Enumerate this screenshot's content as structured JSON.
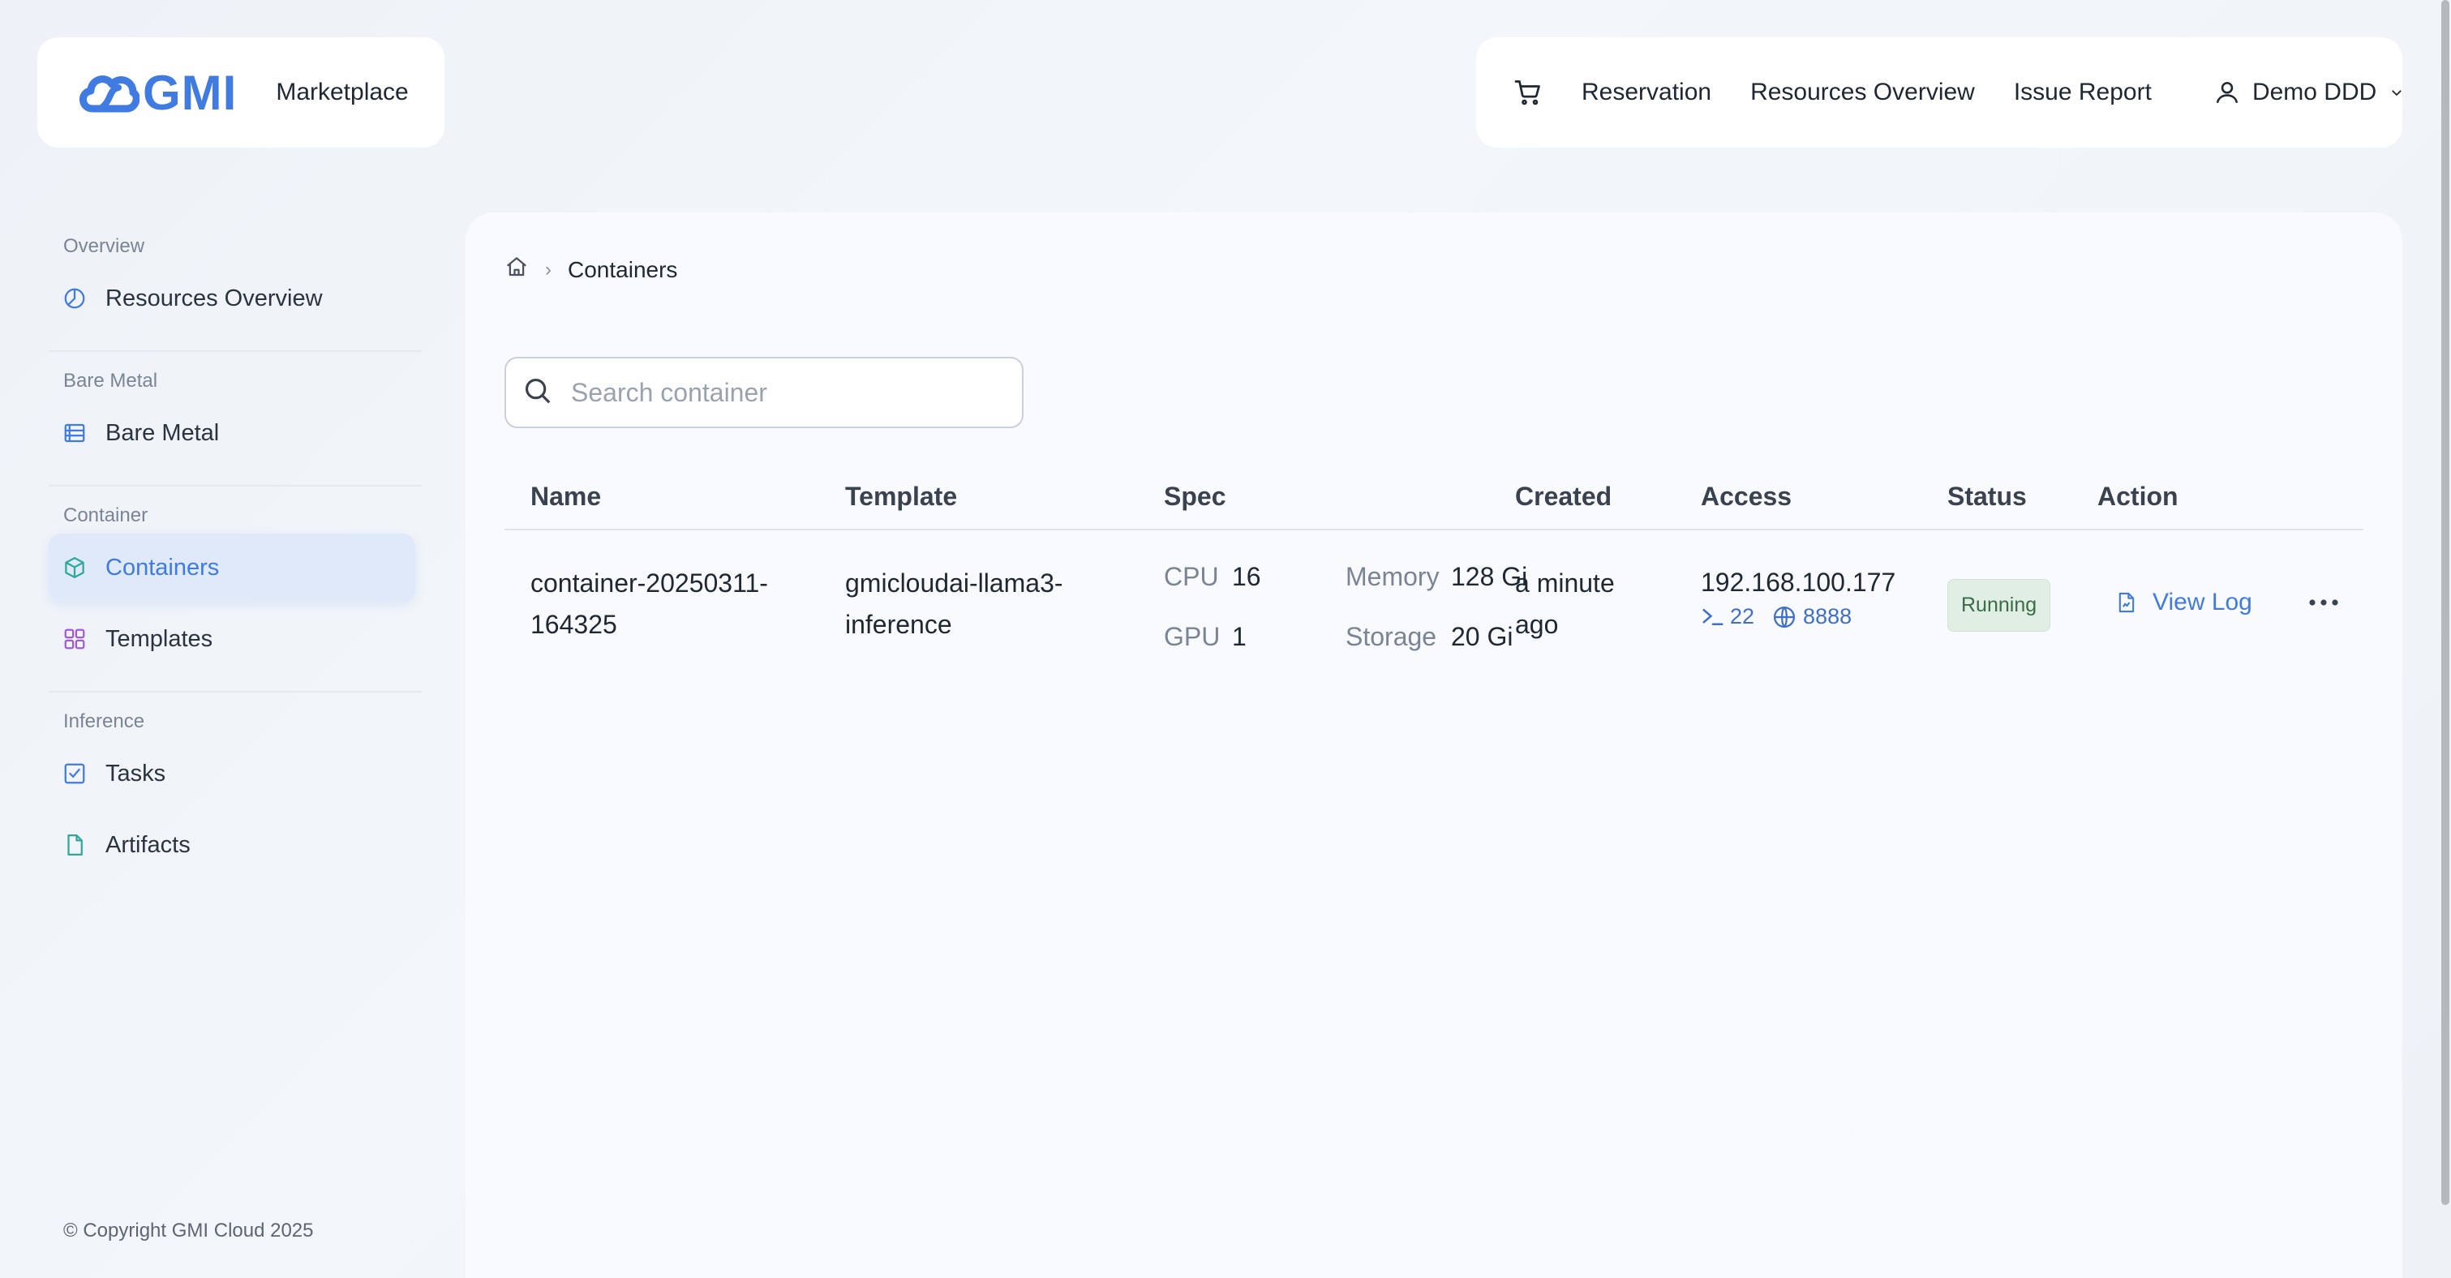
{
  "brand": {
    "logo_text": "GMI",
    "section": "Marketplace",
    "accent": "#3f7be0"
  },
  "topnav": {
    "cart_icon": "cart-icon",
    "links": [
      "Reservation",
      "Resources Overview",
      "Issue Report"
    ],
    "user": "Demo DDD"
  },
  "sidebar": {
    "groups": [
      {
        "label": "Overview",
        "items": [
          {
            "label": "Resources Overview",
            "icon": "pie-chart-icon"
          }
        ]
      },
      {
        "label": "Bare Metal",
        "items": [
          {
            "label": "Bare Metal",
            "icon": "server-list-icon"
          }
        ]
      },
      {
        "label": "Container",
        "items": [
          {
            "label": "Containers",
            "icon": "cube-icon",
            "active": true
          },
          {
            "label": "Templates",
            "icon": "grid-icon"
          }
        ]
      },
      {
        "label": "Inference",
        "items": [
          {
            "label": "Tasks",
            "icon": "checkbox-icon"
          },
          {
            "label": "Artifacts",
            "icon": "file-icon"
          }
        ]
      }
    ],
    "copyright": "© Copyright GMI Cloud 2025"
  },
  "breadcrumb": {
    "current": "Containers"
  },
  "search": {
    "placeholder": "Search container",
    "value": ""
  },
  "table": {
    "columns": [
      "Name",
      "Template",
      "Spec",
      "Created",
      "Access",
      "Status",
      "Action"
    ],
    "rows": [
      {
        "name_line1": "container-20250311-",
        "name_line2": "164325",
        "template_line1": "gmicloudai-llama3-",
        "template_line2": "inference",
        "spec": {
          "cpu_label": "CPU",
          "cpu": "16",
          "memory_label": "Memory",
          "memory": "128 Gi",
          "gpu_label": "GPU",
          "gpu": "1",
          "storage_label": "Storage",
          "storage": "20 Gi"
        },
        "created_line1": "a minute",
        "created_line2": "ago",
        "ip": "192.168.100.177",
        "ssh_port": "22",
        "web_port": "8888",
        "status": "Running",
        "action_label": "View Log"
      }
    ]
  }
}
